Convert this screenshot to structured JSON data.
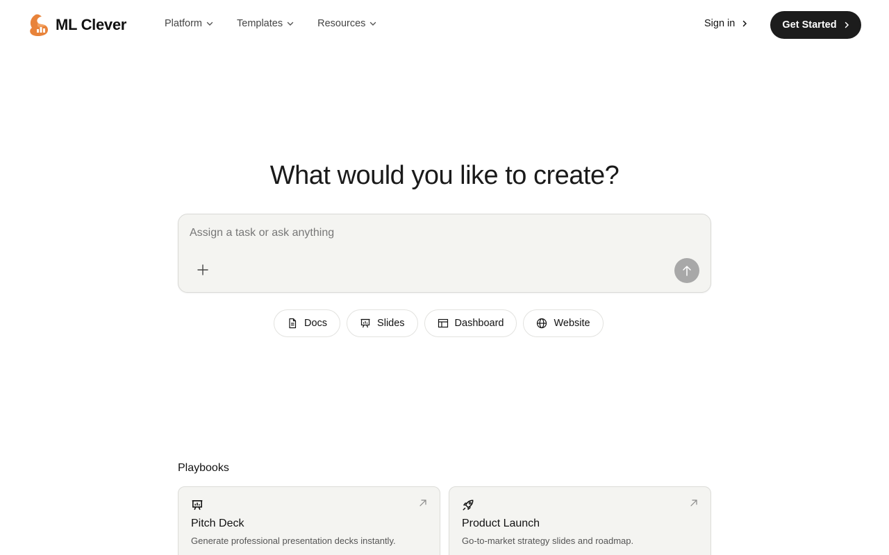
{
  "brand": {
    "name": "ML Clever"
  },
  "nav": {
    "items": [
      {
        "label": "Platform"
      },
      {
        "label": "Templates"
      },
      {
        "label": "Resources"
      }
    ],
    "sign_in": "Sign in",
    "get_started": "Get Started"
  },
  "hero": {
    "title": "What would you like to create?",
    "prompt_placeholder": "Assign a task or ask anything",
    "prompt_value": ""
  },
  "chips": [
    {
      "label": "Docs",
      "icon": "document-icon"
    },
    {
      "label": "Slides",
      "icon": "presentation-icon"
    },
    {
      "label": "Dashboard",
      "icon": "layout-icon"
    },
    {
      "label": "Website",
      "icon": "globe-icon"
    }
  ],
  "playbooks": {
    "title": "Playbooks",
    "cards": [
      {
        "title": "Pitch Deck",
        "description": "Generate professional presentation decks instantly.",
        "icon": "presentation-icon"
      },
      {
        "title": "Product Launch",
        "description": "Go-to-market strategy slides and roadmap.",
        "icon": "rocket-icon"
      }
    ]
  },
  "colors": {
    "primary_button": "#1c1c1c",
    "prompt_bg": "#f4f4f1",
    "send_disabled": "#a8a8a8",
    "brand_orange": "#e8833a"
  }
}
